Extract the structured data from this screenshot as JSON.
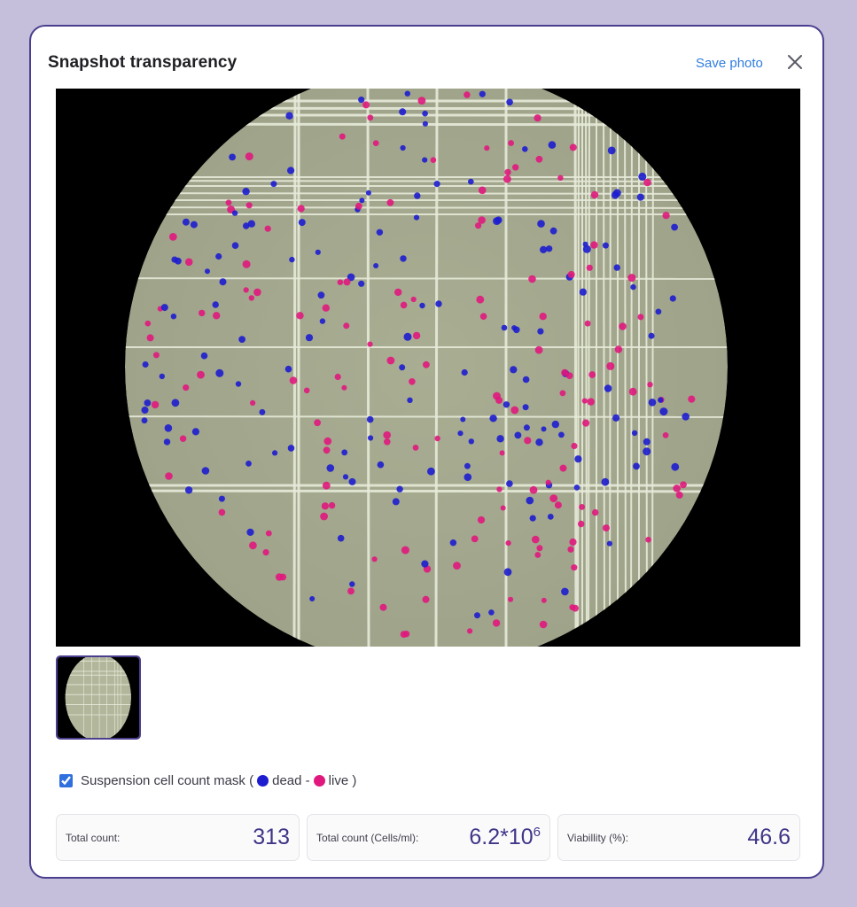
{
  "dialog": {
    "title": "Snapshot transparency",
    "save_label": "Save photo",
    "close_icon": "close-icon"
  },
  "mask": {
    "checked": true,
    "label_prefix": "Suspension cell count mask (",
    "dead_label": "dead -",
    "live_label": "live )",
    "dead_color": "#1d1dcf",
    "live_color": "#e0187d"
  },
  "stats": {
    "total_count_label": "Total count:",
    "total_count_value": "313",
    "cells_ml_label": "Total count (Cells/ml):",
    "cells_ml_base": "6.2*10",
    "cells_ml_exp": "6",
    "viability_label": "Viabillity (%):",
    "viability_value": "46.6"
  }
}
